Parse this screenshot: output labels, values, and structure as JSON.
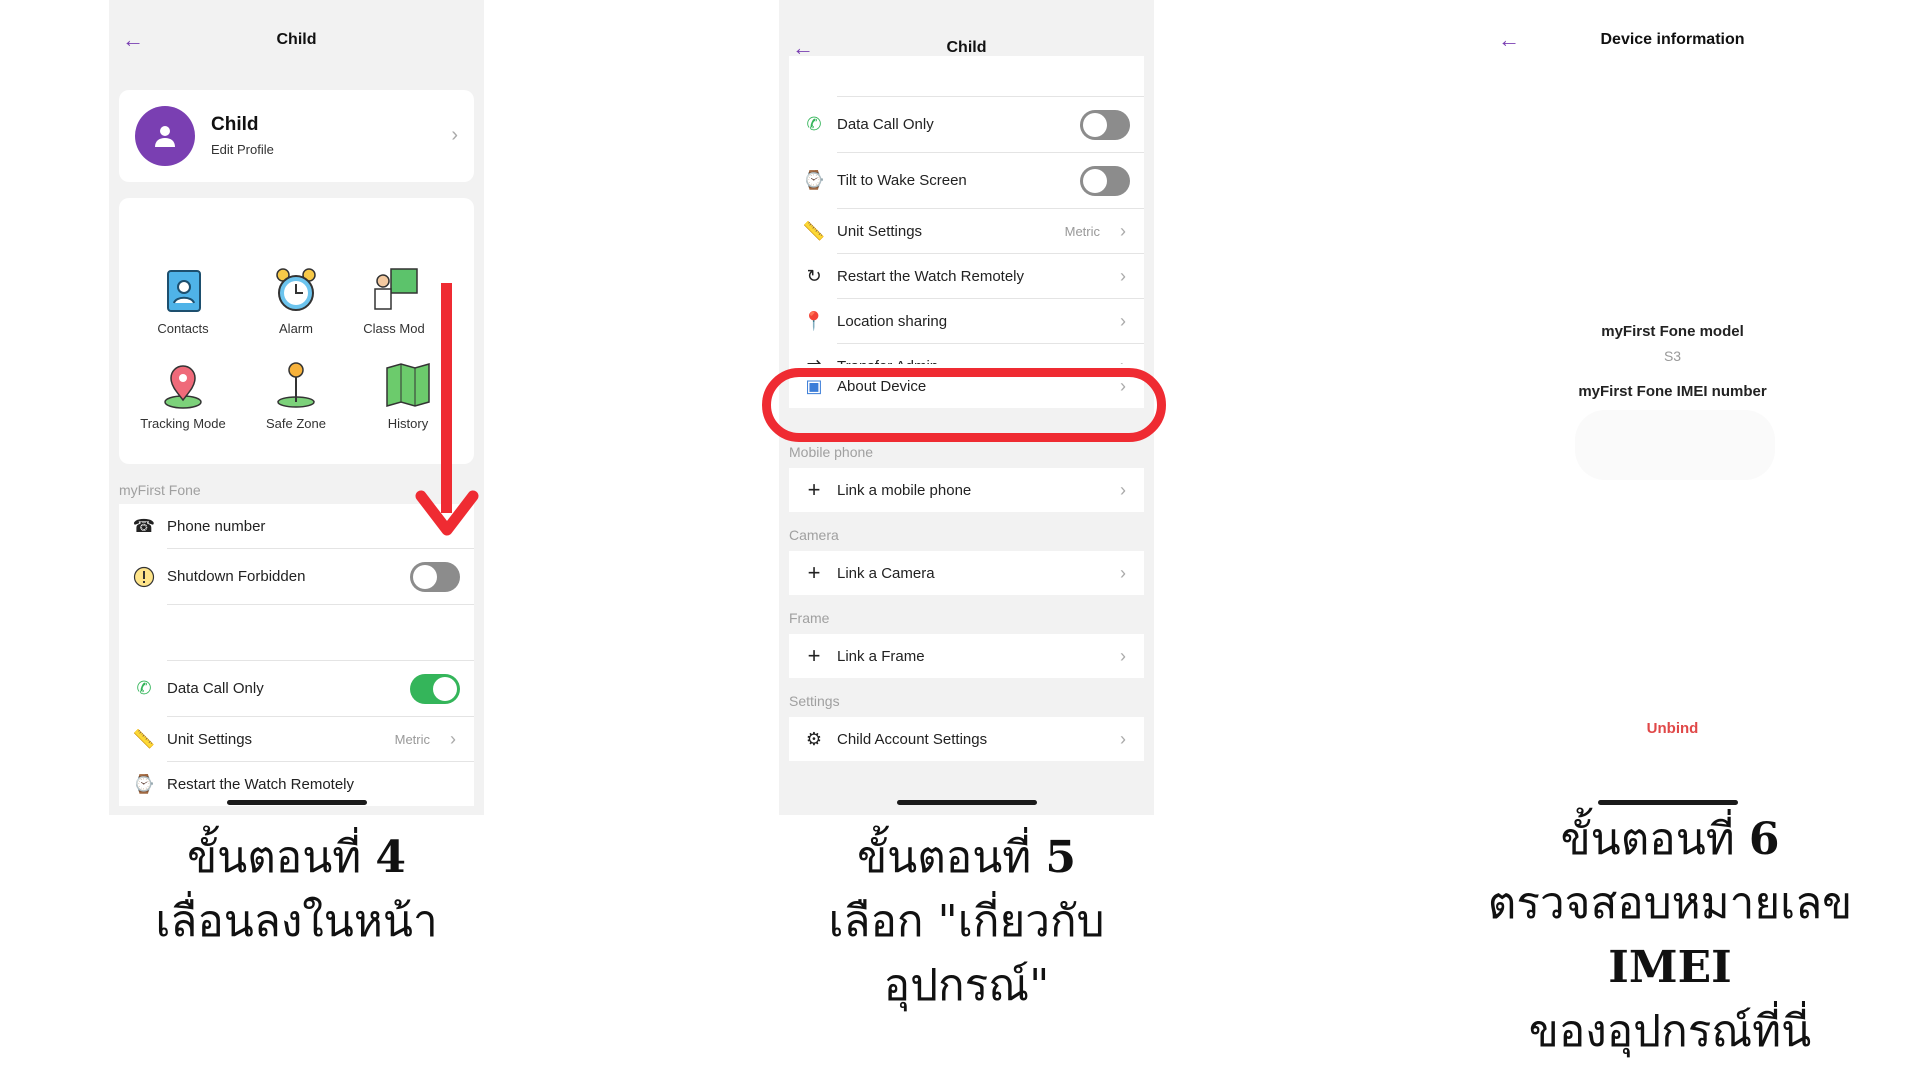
{
  "phone1": {
    "title": "Child",
    "profile": {
      "name": "Child",
      "sub": "Edit Profile"
    },
    "features": [
      {
        "label": "Contacts",
        "icon": "contacts-icon"
      },
      {
        "label": "Alarm",
        "icon": "alarm-icon"
      },
      {
        "label": "Class Mod",
        "icon": "class-mode-icon"
      },
      {
        "label": "Tracking Mode",
        "icon": "tracking-mode-icon"
      },
      {
        "label": "Safe Zone",
        "icon": "safe-zone-icon"
      },
      {
        "label": "History",
        "icon": "history-map-icon"
      }
    ],
    "section_label": "myFirst Fone",
    "rows": {
      "phone_number": "Phone number",
      "shutdown": "Shutdown Forbidden",
      "data_call": "Data Call Only",
      "unit": "Unit Settings",
      "unit_meta": "Metric",
      "restart_partial": "Restart the Watch Remotely"
    }
  },
  "phone2": {
    "title": "Child",
    "rows": {
      "data_call": "Data Call Only",
      "tilt": "Tilt to Wake Screen",
      "unit": "Unit Settings",
      "unit_meta": "Metric",
      "restart": "Restart the Watch Remotely",
      "location": "Location sharing",
      "transfer": "Transfer Admin",
      "about": "About Device"
    },
    "sections": {
      "mobile": "Mobile phone",
      "camera": "Camera",
      "frame": "Frame",
      "settings": "Settings"
    },
    "links": {
      "mobile": "Link a mobile phone",
      "camera": "Link a Camera",
      "frame": "Link a Frame",
      "account": "Child Account Settings"
    }
  },
  "phone3": {
    "title": "Device information",
    "model_label": "myFirst Fone model",
    "model_value": "S3",
    "imei_label": "myFirst Fone IMEI number",
    "unbind": "Unbind"
  },
  "captions": {
    "step4_prefix": "ขั้นตอนที่",
    "step4_num": "4",
    "step4_line2": "เลื่อนลงในหน้า",
    "step5_prefix": "ขั้นตอนที่",
    "step5_num": "5",
    "step5_line2": "เลือก \"เกี่ยวกับ",
    "step5_line3": "อุปกรณ์\"",
    "step6_prefix": "ขั้นตอนที่",
    "step6_num": "6",
    "step6_line2_a": "ตรวจสอบหมายเลข",
    "step6_line2_b": "IMEI",
    "step6_line3": "ของอุปกรณ์ที่นี่"
  },
  "colors": {
    "accent": "#7a3fb2",
    "highlight": "#ef2b32",
    "toggle_on": "#34b55a",
    "unbind": "#e04848"
  }
}
